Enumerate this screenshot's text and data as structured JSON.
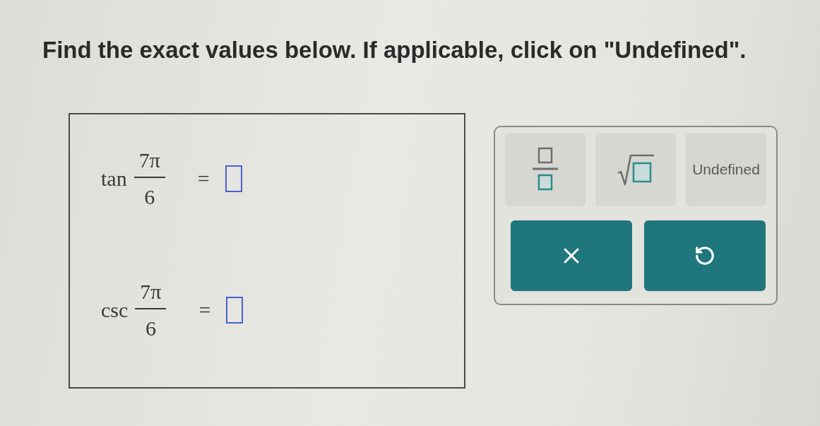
{
  "instruction": "Find the exact values below. If applicable, click on \"Undefined\".",
  "problems": [
    {
      "function": "tan",
      "numerator": "7π",
      "denominator": "6",
      "equals": "="
    },
    {
      "function": "csc",
      "numerator": "7π",
      "denominator": "6",
      "equals": "="
    }
  ],
  "keypad": {
    "keys": [
      {
        "kind": "fraction"
      },
      {
        "kind": "sqrt"
      },
      {
        "kind": "text",
        "label": "Undefined"
      }
    ],
    "actions": [
      {
        "kind": "clear"
      },
      {
        "kind": "undo"
      }
    ]
  }
}
